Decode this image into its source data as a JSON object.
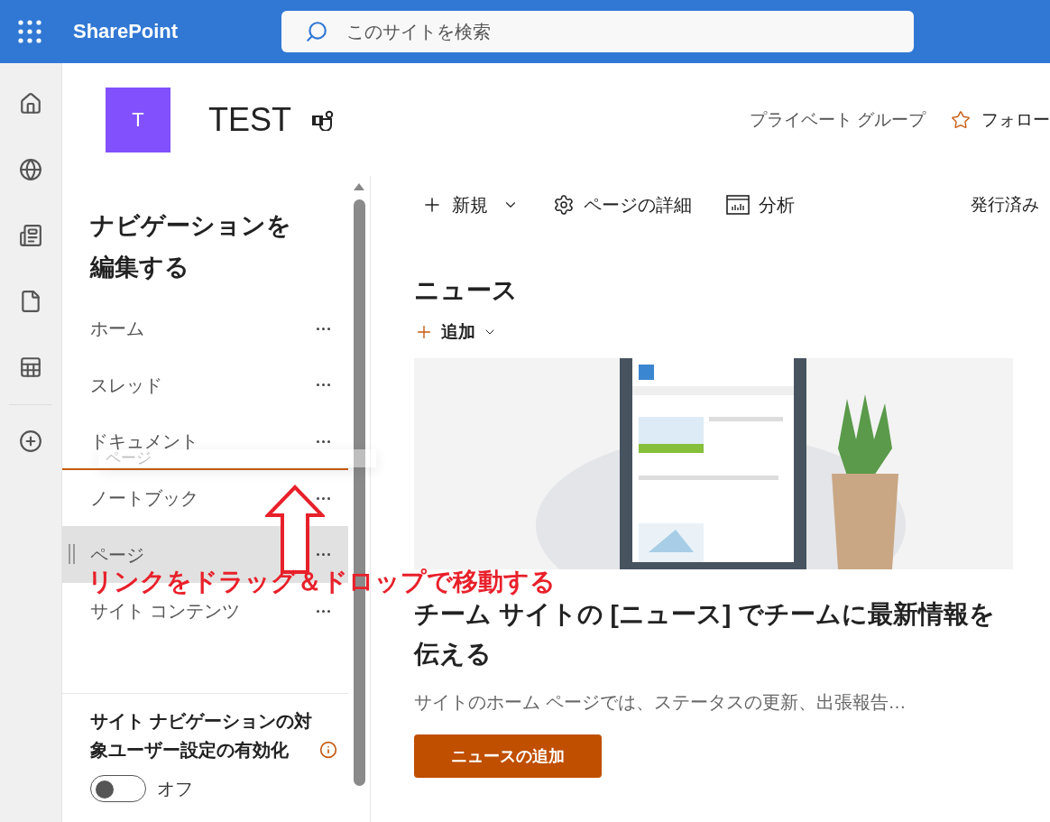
{
  "app_bar": {
    "product": "SharePoint",
    "search": {
      "placeholder": "このサイトを検索"
    }
  },
  "site": {
    "logo_letter": "T",
    "title": "TEST",
    "privacy": "プライベート グループ",
    "follow": "フォロー"
  },
  "nav_editor": {
    "heading": "ナビゲーションを編集する",
    "items": [
      {
        "label": "ホーム",
        "selected": false,
        "drop_below": false
      },
      {
        "label": "スレッド",
        "selected": false,
        "drop_below": false
      },
      {
        "label": "ドキュメント",
        "selected": false,
        "drop_below": true
      },
      {
        "label": "ノートブック",
        "selected": false,
        "drop_below": false
      },
      {
        "label": "ページ",
        "selected": true,
        "drop_below": false
      },
      {
        "label": "サイト コンテンツ",
        "selected": false,
        "drop_below": false
      }
    ],
    "drag": {
      "label": "ページ"
    },
    "audience": {
      "label": "サイト ナビゲーションの対象ユーザー設定の有効化",
      "toggle": {
        "on": false,
        "label": "オフ"
      }
    }
  },
  "command_bar": {
    "new": "新規",
    "details": "ページの詳細",
    "analytics": "分析",
    "status": "発行済み"
  },
  "news": {
    "title": "ニュース",
    "add": "追加",
    "headline": "チーム サイトの [ニュース] でチームに最新情報を伝える",
    "description": "サイトのホーム ページでは、ステータスの更新、出張報告…",
    "button": "ニュースの追加"
  },
  "annotation": {
    "text": "リンクをドラッグ＆ドロップで移動する"
  }
}
